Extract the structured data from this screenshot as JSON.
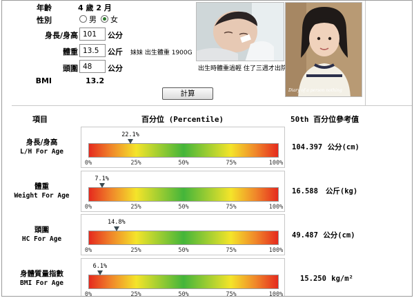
{
  "form": {
    "age_label": "年齡",
    "age_value": "4 歲 2 月",
    "gender_label": "性別",
    "gender_options": [
      "男",
      "女"
    ],
    "gender_selected": "女",
    "height_label": "身長/身高",
    "height_value": "101",
    "height_unit": "公分",
    "weight_label": "體重",
    "weight_value": "13.5",
    "weight_unit": "公斤",
    "weight_note": "妹妹 出生體重 1900G",
    "head_label": "頭圍",
    "head_value": "48",
    "head_unit": "公分",
    "bmi_label": "BMI",
    "bmi_value": "13.2",
    "calc_button": "計算"
  },
  "photos": {
    "caption": "出生時體重過輕 住了三週才出院",
    "watermark": "Diary of a person nothing"
  },
  "results": {
    "header_item": "項目",
    "header_percentile": "百分位  (Percentile)",
    "header_ref": "50th 百分位參考值",
    "ticks": [
      "0%",
      "25%",
      "50%",
      "75%",
      "100%"
    ],
    "rows": [
      {
        "zh": "身長/身高",
        "en": "L/H For Age",
        "percentile": 22.1,
        "percent_label": "22.1%",
        "ref_value": "104.397",
        "ref_unit": "公分(cm)"
      },
      {
        "zh": "體重",
        "en": "Weight For Age",
        "percentile": 7.1,
        "percent_label": "7.1%",
        "ref_value": "16.588",
        "ref_unit": "公斤(kg)"
      },
      {
        "zh": "頭圍",
        "en": "HC For Age",
        "percentile": 14.8,
        "percent_label": "14.8%",
        "ref_value": "49.487",
        "ref_unit": "公分(cm)"
      },
      {
        "zh": "身體質量指數",
        "en": "BMI For Age",
        "percentile": 6.1,
        "percent_label": "6.1%",
        "ref_value": "15.250",
        "ref_unit": "kg/m²"
      }
    ]
  },
  "colors": {
    "marker": "#3a4a52",
    "radio_selected": "#2f7a2f",
    "gradient_low": "#e52a1e",
    "gradient_mid": "#44b53a",
    "gradient_yellow": "#f4e42a"
  }
}
